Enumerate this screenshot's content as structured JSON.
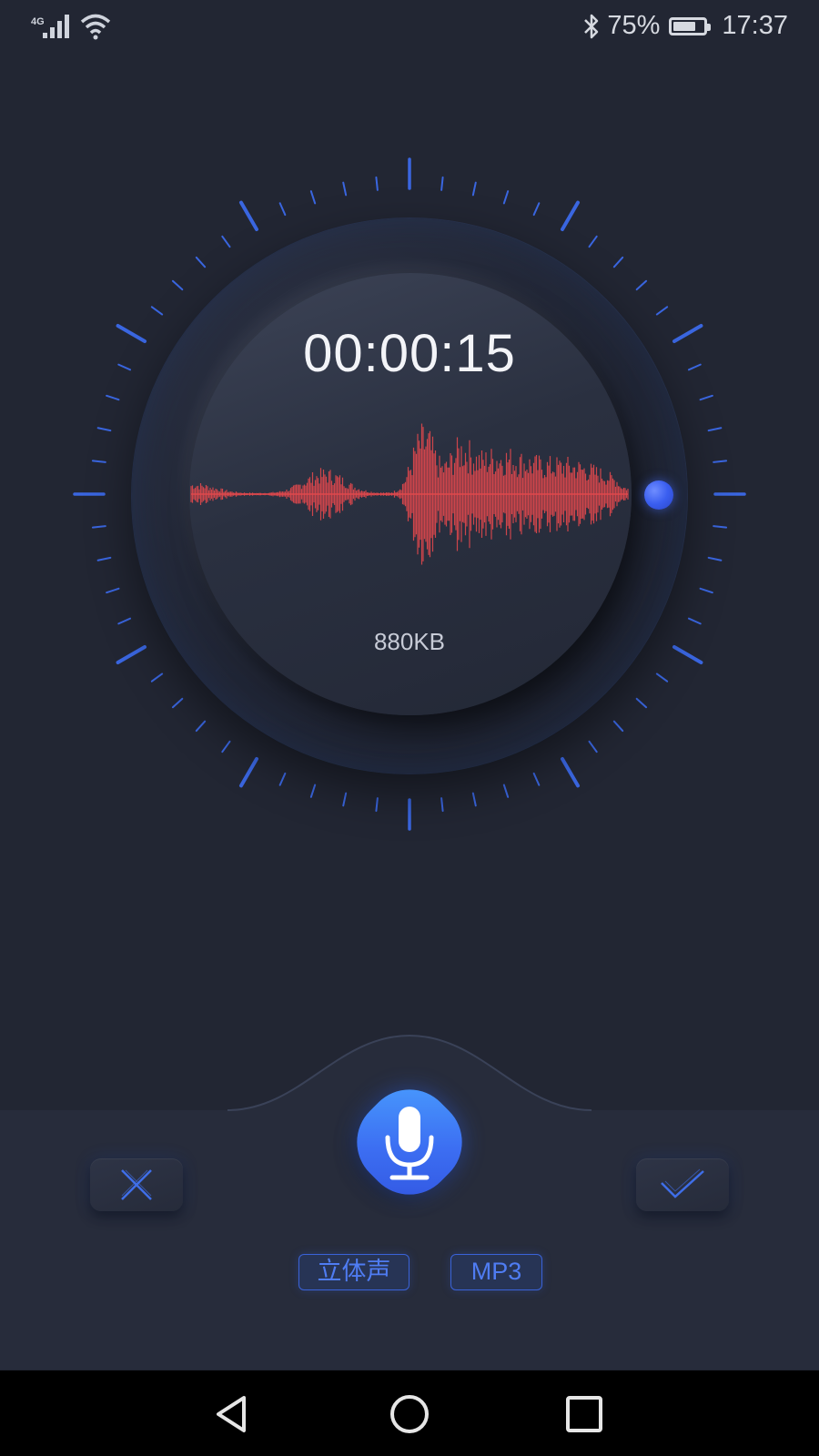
{
  "status_bar": {
    "network": "4G",
    "battery_percent_text": "75%",
    "battery_level": 0.75,
    "time": "17:37"
  },
  "recorder": {
    "elapsed": "00:00:15",
    "file_size": "880KB"
  },
  "controls": {
    "cancel_icon": "close-icon",
    "confirm_icon": "check-icon",
    "record_icon": "microphone-icon",
    "channel_mode": "立体声",
    "format": "MP3"
  },
  "colors": {
    "accent": "#3c6ef2",
    "tick": "#3a66e0",
    "waveform": "#e0484c",
    "background": "#222633"
  },
  "nav": {
    "back_icon": "back-triangle-icon",
    "home_icon": "home-circle-icon",
    "recents_icon": "recents-square-icon"
  }
}
